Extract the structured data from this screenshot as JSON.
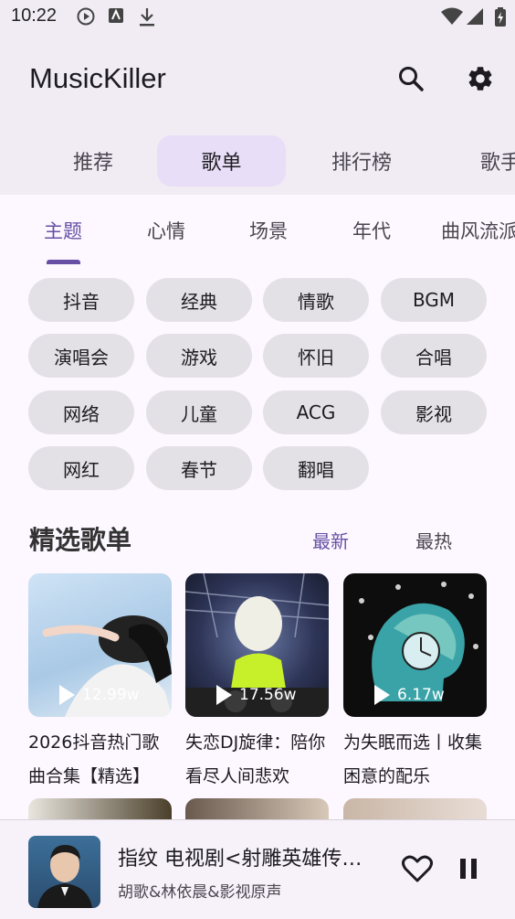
{
  "status_bar": {
    "time": "10:22"
  },
  "app": {
    "title": "MusicKiller"
  },
  "top_tabs": [
    "推荐",
    "歌单",
    "排行榜",
    "歌手"
  ],
  "sub_tabs": [
    "主题",
    "心情",
    "场景",
    "年代",
    "曲风流派"
  ],
  "chips": [
    "抖音",
    "经典",
    "情歌",
    "BGM",
    "演唱会",
    "游戏",
    "怀旧",
    "合唱",
    "网络",
    "儿童",
    "ACG",
    "影视",
    "网红",
    "春节",
    "翻唱"
  ],
  "section": {
    "title": "精选歌单",
    "sort_latest": "最新",
    "sort_hot": "最热"
  },
  "playlists": [
    {
      "title": "2026抖音热门歌曲合集【精选】",
      "plays": "12.99w"
    },
    {
      "title": "失恋DJ旋律：陪你看尽人间悲欢",
      "plays": "17.56w"
    },
    {
      "title": "为失眠而选丨收集困意的配乐",
      "plays": "6.17w"
    }
  ],
  "now_playing": {
    "title": "指纹 电视剧<射雕英雄传…",
    "artist": "胡歌&林依晨&影视原声"
  },
  "colors": {
    "accent": "#6750a4",
    "surface": "#f1ecf4",
    "chip": "#e4e1e6"
  }
}
